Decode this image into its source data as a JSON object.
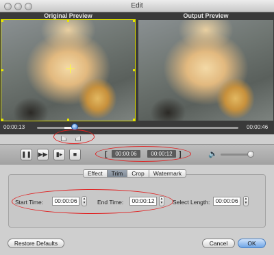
{
  "window": {
    "title": "Edit"
  },
  "previews": {
    "original_label": "Original Preview",
    "output_label": "Output Preview"
  },
  "timeline": {
    "current_time": "00:00:13",
    "total_time": "00:00:46",
    "position_fraction": 0.28
  },
  "playback": {
    "play_pause_icon": "pause-icon",
    "forward_icon": "fast-forward-icon",
    "frame_icon": "frame-step-icon",
    "stop_icon": "stop-icon",
    "start_display": "00:00:06",
    "end_display": "00:00:12"
  },
  "volume": {
    "icon": "speaker-icon",
    "level": 0.85
  },
  "tabs": [
    {
      "label": "Effect",
      "active": false
    },
    {
      "label": "Trim",
      "active": true
    },
    {
      "label": "Crop",
      "active": false
    },
    {
      "label": "Watermark",
      "active": false
    }
  ],
  "trim": {
    "start_label": "Start Time:",
    "start_value": "00:00:06",
    "end_label": "End Time:",
    "end_value": "00:00:12",
    "length_label": "Select Length:",
    "length_value": "00:00:06"
  },
  "buttons": {
    "restore": "Restore Defaults",
    "cancel": "Cancel",
    "ok": "OK"
  },
  "colors": {
    "annotation": "#e02020",
    "crop_outline": "#d6d600",
    "slider_knob": "#2c71c9",
    "ok_button": "#6ea5e6"
  }
}
